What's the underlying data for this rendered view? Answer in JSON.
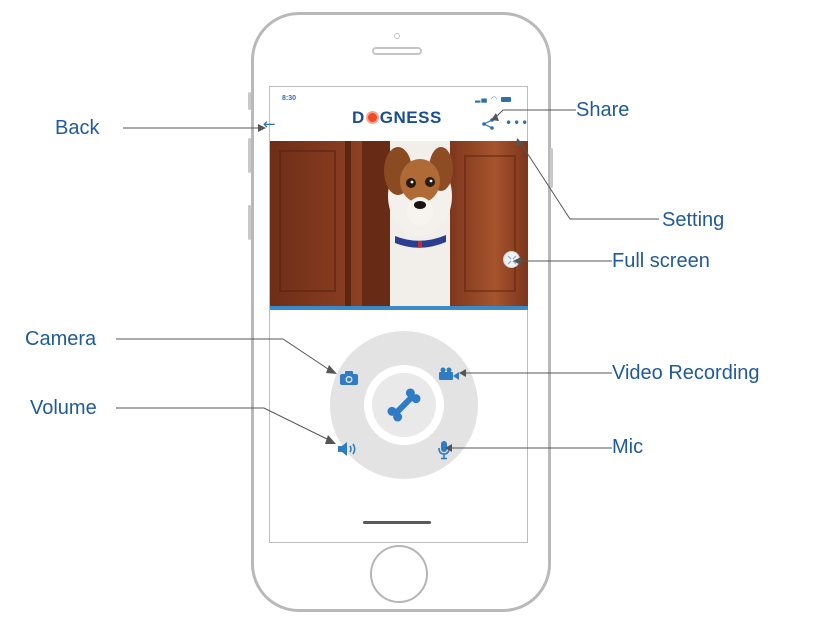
{
  "status_bar": {
    "time": "8:30"
  },
  "app": {
    "logo_text_left": "D",
    "logo_text_right": "GNESS"
  },
  "annotations": {
    "back": "Back",
    "share": "Share",
    "setting": "Setting",
    "full_screen": "Full screen",
    "camera": "Camera",
    "video_recording": "Video Recording",
    "volume": "Volume",
    "mic": "Mic"
  },
  "icons": {
    "back": "arrow-left-icon",
    "share": "share-icon",
    "setting": "more-dots-icon",
    "full_screen": "fullscreen-icon",
    "camera": "camera-icon",
    "video_recording": "video-camera-icon",
    "volume": "speaker-icon",
    "mic": "microphone-icon",
    "center": "bone-icon"
  },
  "colors": {
    "accent": "#2f6fae",
    "label": "#1f5a9c",
    "logo": "#1a4f91",
    "logo_dot": "#ef4a26",
    "wheel": "#e3e3e3"
  }
}
